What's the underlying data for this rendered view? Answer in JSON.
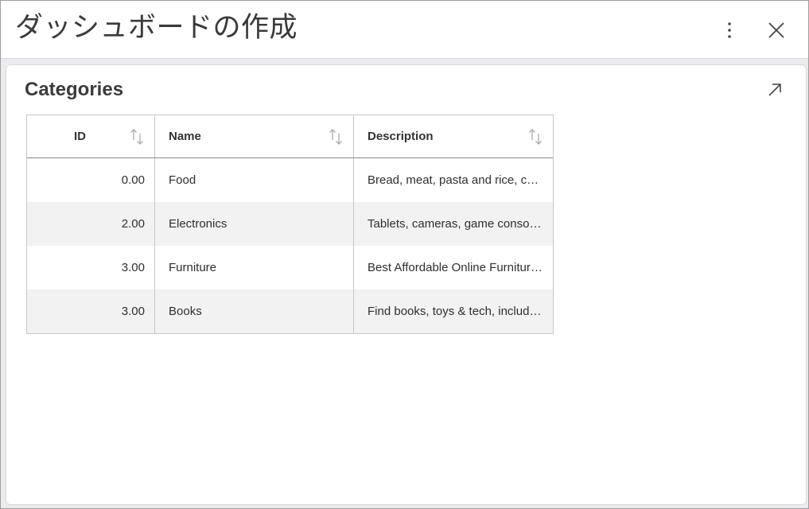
{
  "window": {
    "title": "ダッシュボードの作成"
  },
  "toolbar": {
    "more_icon": "more-vertical-icon",
    "close_icon": "close-icon"
  },
  "panel": {
    "title": "Categories",
    "expand_icon": "expand-arrow-icon"
  },
  "table": {
    "columns": [
      {
        "label": "ID",
        "sort_icon": "sort-icon"
      },
      {
        "label": "Name",
        "sort_icon": "sort-icon"
      },
      {
        "label": "Description",
        "sort_icon": "sort-icon"
      }
    ],
    "rows": [
      {
        "id": "0.00",
        "name": "Food",
        "description": "Bread, meat, pasta and rice, cer…"
      },
      {
        "id": "2.00",
        "name": "Electronics",
        "description": "Tablets, cameras, game consol…"
      },
      {
        "id": "3.00",
        "name": "Furniture",
        "description": "Best Affordable Online Furnitur…"
      },
      {
        "id": "3.00",
        "name": "Books",
        "description": "Find books, toys & tech, includi…"
      }
    ]
  },
  "colors": {
    "row_alt": "#f2f2f2",
    "panel_bg": "#ffffff",
    "window_bg": "#ecebf0"
  }
}
